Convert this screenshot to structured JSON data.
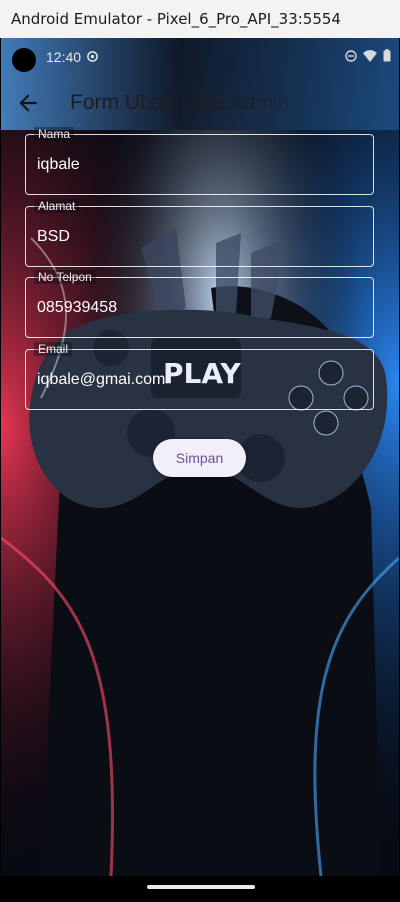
{
  "window": {
    "title": "Android Emulator - Pixel_6_Pro_API_33:5554"
  },
  "status_bar": {
    "time": "12:40",
    "icons": [
      "settings-icon",
      "dnd-icon",
      "wifi-icon",
      "battery-icon"
    ]
  },
  "app_bar": {
    "title": "Form Ubah Data Admin",
    "back_icon": "back-arrow-icon"
  },
  "form": {
    "fields": [
      {
        "label": "Nama",
        "value": "iqbale"
      },
      {
        "label": "Alamat",
        "value": "BSD"
      },
      {
        "label": "No Telpon",
        "value": "085939458"
      },
      {
        "label": "Email",
        "value": "iqbale@gmai.com"
      }
    ],
    "submit_label": "Simpan"
  },
  "background": {
    "controller_text": "PLAY"
  },
  "colors": {
    "button_text": "#6750a4",
    "button_bg": "#f3eff8",
    "field_border": "#ffffff"
  }
}
